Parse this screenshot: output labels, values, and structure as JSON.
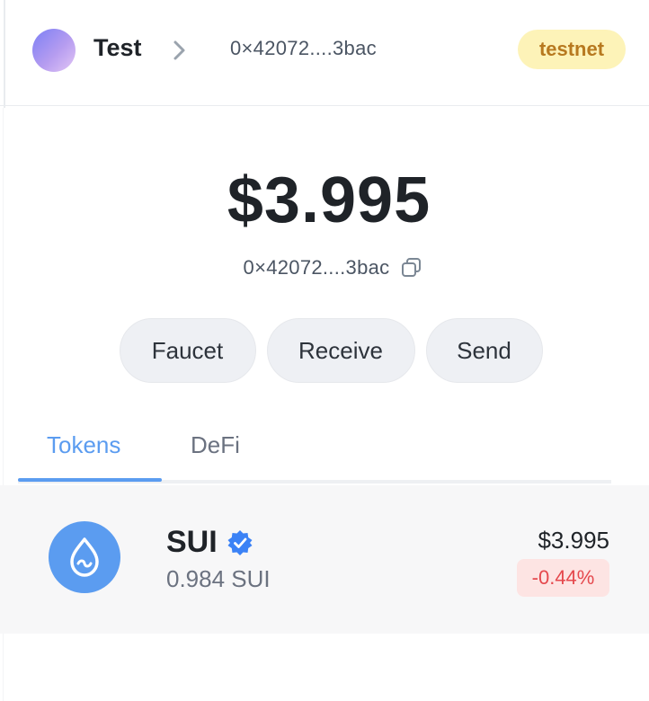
{
  "header": {
    "account_name": "Test",
    "address_short": "0×42072....3bac",
    "network_badge": "testnet"
  },
  "balance": {
    "amount": "$3.995",
    "address_short": "0×42072....3bac"
  },
  "actions": {
    "faucet_label": "Faucet",
    "receive_label": "Receive",
    "send_label": "Send"
  },
  "tabs": [
    {
      "label": "Tokens",
      "active": true
    },
    {
      "label": "DeFi",
      "active": false
    }
  ],
  "tokens": [
    {
      "symbol": "SUI",
      "amount": "0.984 SUI",
      "value": "$3.995",
      "change": "-0.44%",
      "icon": "sui-droplet-icon",
      "verified": true
    }
  ],
  "colors": {
    "accent": "#5b9cf0",
    "badge_bg": "#fdf3b8",
    "badge_text": "#b7791f",
    "negative": "#e5484d",
    "negative_bg": "#fde4e3"
  }
}
